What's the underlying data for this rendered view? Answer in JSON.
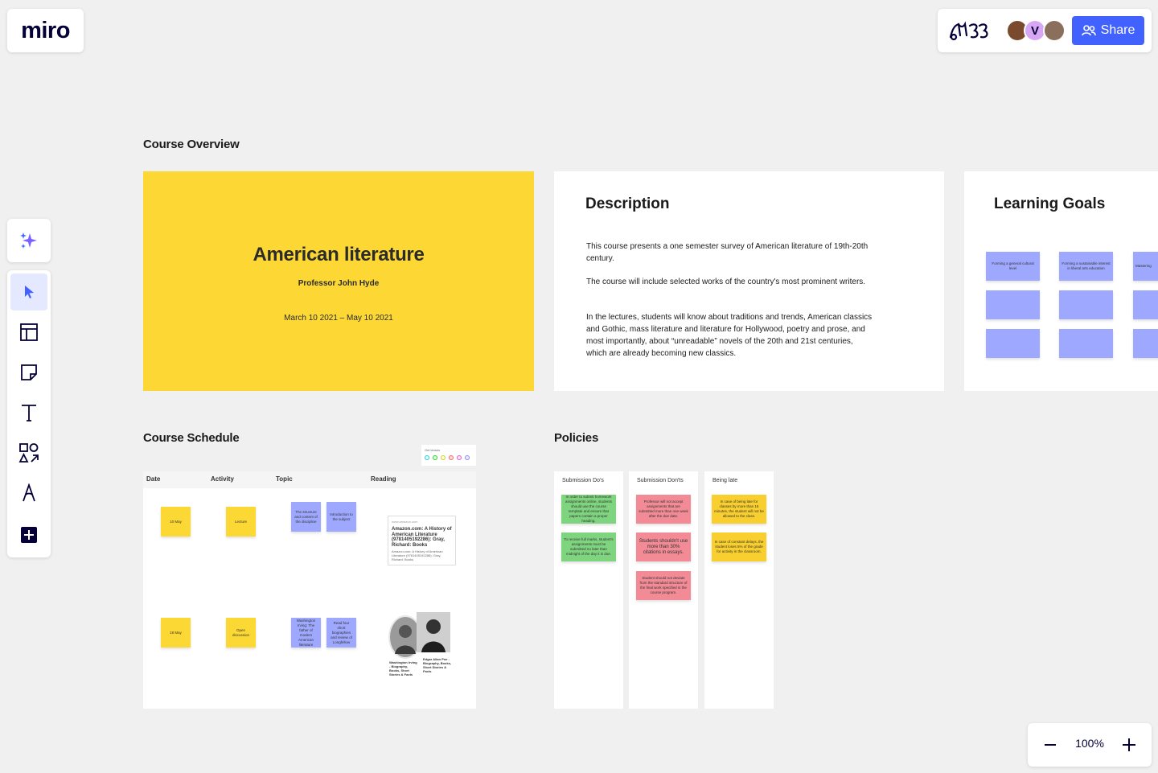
{
  "app": {
    "logo": "miro",
    "share_label": "Share",
    "zoom_level": "100%",
    "avatar_v": "V"
  },
  "board": {
    "overview_title": "Course Overview",
    "hero": {
      "title": "American literature",
      "professor": "Professor John Hyde",
      "dates": "March 10 2021 – May 10 2021"
    },
    "description": {
      "title": "Description",
      "p1": "This course presents a one semester survey of American literature of 19th-20th century.",
      "p2": "The course will include selected works of the country's most prominent writers.",
      "p3": "In the lectures, students will know about traditions and trends, American classics and Gothic, mass literature and literature for Hollywood, poetry and prose, and most importantly, about “unreadable” novels of the 20th and 21st centuries, which are already becoming new classics."
    },
    "goals": {
      "title": "Learning Goals",
      "notes": [
        "Forming a general cultural level",
        "Forming a sustainable interest in liberal arts education",
        "Mastering"
      ]
    },
    "schedule": {
      "title": "Course Schedule",
      "columns": [
        "Date",
        "Activity",
        "Topic",
        "Reading"
      ],
      "legend_label": "Get lenses",
      "rows": [
        {
          "date": "10 May",
          "activity": "Lecture",
          "topic1": "The structure and content of the discipline",
          "topic2": "Introduction to the subject",
          "ref_source": "www.amazon.com",
          "ref_title": "Amazon.com: A History of American Literature (9781405192286): Gray, Richard: Books",
          "ref_body": "Amazon.com: A History of American Literature (9781405192286): Gray, Richard: Books"
        },
        {
          "date": "18 May",
          "activity": "Open discussion",
          "topic1": "Washington Irving: The father of modern American literature",
          "topic2": "Read four short biographies and review of Longfellow",
          "ref_title": "Washington Irving - Biography, Books, Short Stories & Facts",
          "ref_title2": "Edgar Allan Poe - Biography, Books, Short Stories & Facts"
        }
      ]
    },
    "policies": {
      "title": "Policies",
      "columns": [
        {
          "title": "Submission Do's",
          "notes": [
            "In order to submit homework assignments online, students should use the course template and ensure that papers contain a proper heading.",
            "To receive full marks, student's assignments must be submitted no later than midnight of the day it is due."
          ]
        },
        {
          "title": "Submission Don'ts",
          "notes": [
            "Professor will not accept assignments that are submitted more than one week after the due date.",
            "Students shouldn't use more than 30% citations in essays.",
            "Student should not deviate from the standard structure of the final work specified in the course program."
          ]
        },
        {
          "title": "Being late",
          "notes": [
            "In case of being late for classes by more than 15 minutes, the student will not be allowed to the class.",
            "In case of constant delays, the student loses 5% of the grade for activity in the classroom."
          ]
        }
      ]
    }
  },
  "colors": {
    "accent": "#4262ff",
    "hero_yellow": "#fdd835",
    "sticky_purple": "#9ea8ff",
    "sticky_green": "#7fd47f",
    "sticky_red": "#f28b96"
  }
}
